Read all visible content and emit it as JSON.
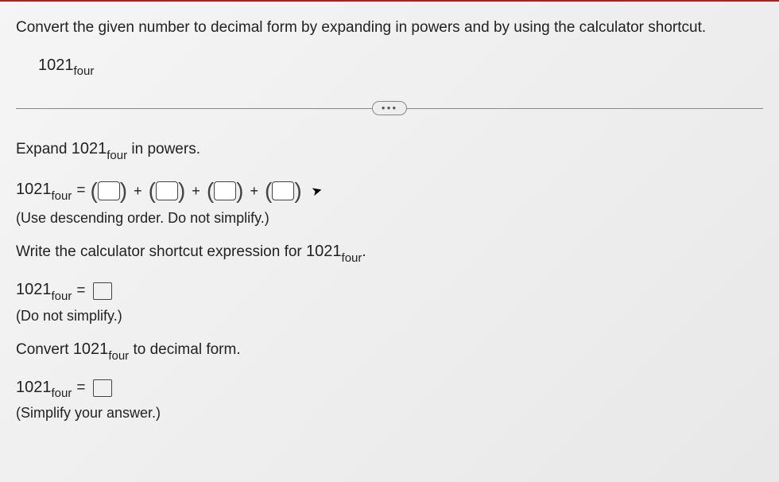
{
  "question": "Convert the given number to decimal form by expanding in powers and by using the calculator shortcut.",
  "number": "1021",
  "base": "four",
  "step1": {
    "prompt_prefix": "Expand ",
    "prompt_suffix": " in powers.",
    "hint": "(Use descending order. Do not simplify.)"
  },
  "step2": {
    "prompt_prefix": "Write the calculator shortcut expression for ",
    "prompt_suffix": ".",
    "hint": "(Do not simplify.)"
  },
  "step3": {
    "prompt_prefix": "Convert ",
    "prompt_suffix": " to decimal form.",
    "hint": "(Simplify your answer.)"
  },
  "symbols": {
    "equals": "=",
    "plus": "+",
    "lparen": "(",
    "rparen": ")"
  }
}
